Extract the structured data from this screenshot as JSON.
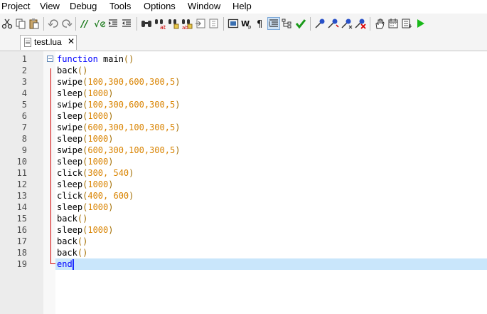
{
  "menu": [
    "Project",
    "View",
    "Debug",
    "Tools",
    "Options",
    "Window",
    "Help"
  ],
  "toolbar": {
    "icons": [
      "cut-icon",
      "copy-icon",
      "paste-icon",
      "undo-icon",
      "redo-icon",
      "comment-icon",
      "uncomment-icon",
      "indent-icon",
      "outdent-icon",
      "find-icon",
      "replace-icon",
      "find-in-files-icon",
      "replace-in-files-icon",
      "goto-icon",
      "bookmark-icon",
      "fullscreen-icon",
      "word-wrap-icon",
      "show-whitespace-icon",
      "indent-guides-icon",
      "tree-icon",
      "check-icon",
      "breakpoint-icon",
      "step-into-icon",
      "step-over-icon",
      "clear-breakpoints-icon",
      "hand-icon",
      "calendar-icon",
      "note-icon",
      "run-icon"
    ]
  },
  "tab": {
    "label": "test.lua",
    "close": "✕"
  },
  "editor": {
    "line_numbers": [
      "1",
      "2",
      "3",
      "4",
      "5",
      "6",
      "7",
      "8",
      "9",
      "10",
      "11",
      "12",
      "13",
      "14",
      "15",
      "16",
      "17",
      "18",
      "19"
    ],
    "lines": [
      {
        "kw": "function",
        "fn": " main",
        "args": "()"
      },
      {
        "fn": "back",
        "args": "()"
      },
      {
        "fn": "swipe",
        "open": "(",
        "nums": "100,300,600,300,5",
        "close": ")"
      },
      {
        "fn": "sleep",
        "open": "(",
        "nums": "1000",
        "close": ")"
      },
      {
        "fn": "swipe",
        "open": "(",
        "nums": "100,300,600,300,5",
        "close": ")"
      },
      {
        "fn": "sleep",
        "open": "(",
        "nums": "1000",
        "close": ")"
      },
      {
        "fn": "swipe",
        "open": "(",
        "nums": "600,300,100,300,5",
        "close": ")"
      },
      {
        "fn": "sleep",
        "open": "(",
        "nums": "1000",
        "close": ")"
      },
      {
        "fn": "swipe",
        "open": "(",
        "nums": "600,300,100,300,5",
        "close": ")"
      },
      {
        "fn": "sleep",
        "open": "(",
        "nums": "1000",
        "close": ")"
      },
      {
        "fn": "click",
        "open": "(",
        "nums": "300, 540",
        "close": ")"
      },
      {
        "fn": "sleep",
        "open": "(",
        "nums": "1000",
        "close": ")"
      },
      {
        "fn": "click",
        "open": "(",
        "nums": "400, 600",
        "close": ")"
      },
      {
        "fn": "sleep",
        "open": "(",
        "nums": "1000",
        "close": ")"
      },
      {
        "fn": "back",
        "args": "()"
      },
      {
        "fn": "sleep",
        "open": "(",
        "nums": "1000",
        "close": ")"
      },
      {
        "fn": "back",
        "args": "()"
      },
      {
        "fn": "back",
        "args": "()"
      },
      {
        "kw": "end"
      }
    ]
  }
}
